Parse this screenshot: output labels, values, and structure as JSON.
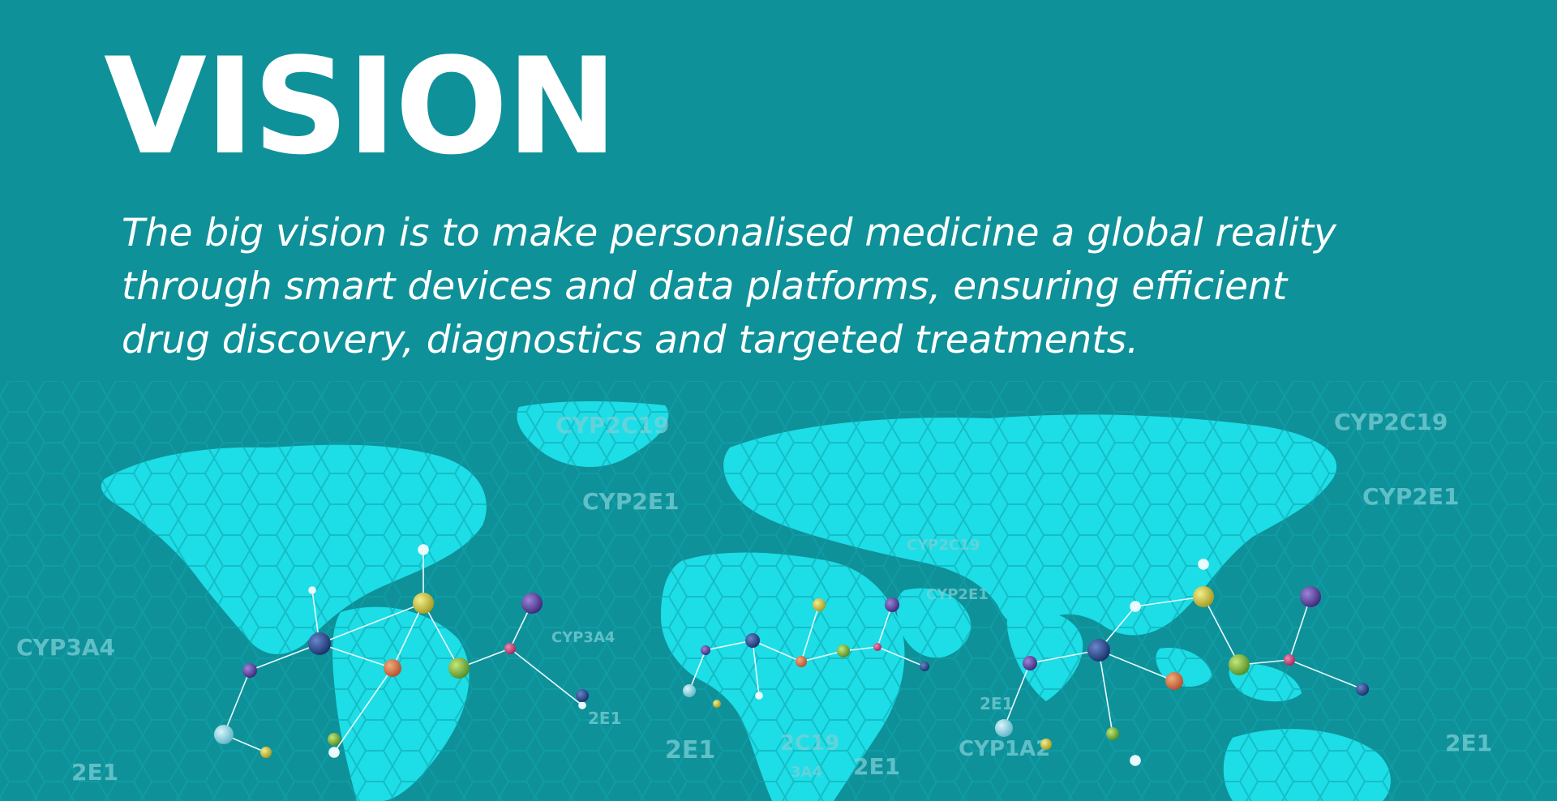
{
  "heading": "VISION",
  "statement": {
    "line1": "The big vision is to make personalised medicine a global reality",
    "line2": "through smart devices and data platforms, ensuring efficient",
    "line3": "drug discovery, diagnostics and targeted treatments."
  },
  "map_labels": [
    "CYP2C19",
    "CYP2E1",
    "CYP3A4",
    "CYP2C19",
    "CYP2E1",
    "CYP3A4",
    "CYP2C19",
    "CYP2E1",
    "2E1",
    "2E1",
    "2C19",
    "3A4",
    "2E1",
    "2E1",
    "CYP1A2",
    "2E1",
    "2E1"
  ],
  "colors": {
    "background": "#0f9199",
    "land": "#1ddde6",
    "text": "#ffffff",
    "label": "#7bcfd6"
  },
  "icons": [
    "world-map",
    "molecule-network"
  ]
}
